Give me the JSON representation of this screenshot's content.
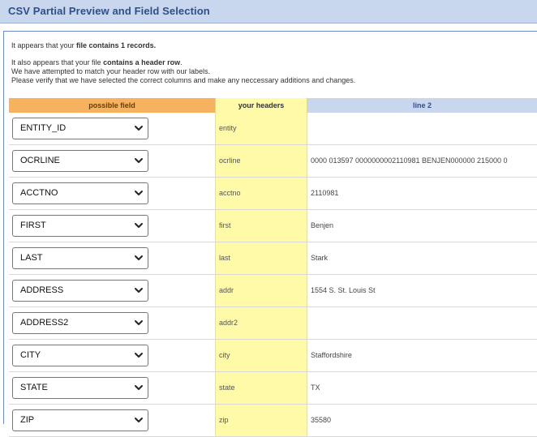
{
  "page": {
    "title": "CSV Partial Preview and Field Selection"
  },
  "intro": {
    "line1_pre": "It appears that your ",
    "line1_bold": "file contains 1 records.",
    "line2_pre": "It also appears that your file ",
    "line2_bold": "contains a header row",
    "line2_post": ".",
    "line3": "We have attempted to match your header row with our labels.",
    "line4": "Please verify that we have selected the correct columns and make any neccessary additions and changes."
  },
  "table": {
    "headers": {
      "possible_field": "possible field",
      "your_headers": "your headers",
      "line2": "line 2"
    },
    "rows": [
      {
        "field": "ENTITY_ID",
        "header": "entity",
        "value": ""
      },
      {
        "field": "OCRLINE",
        "header": "ocrline",
        "value": "0000 013597 0000000002110981 BENJEN000000 215000 0"
      },
      {
        "field": "ACCTNO",
        "header": "acctno",
        "value": "2110981"
      },
      {
        "field": "FIRST",
        "header": "first",
        "value": "Benjen"
      },
      {
        "field": "LAST",
        "header": "last",
        "value": "Stark"
      },
      {
        "field": "ADDRESS",
        "header": "addr",
        "value": "1554 S. St. Louis St"
      },
      {
        "field": "ADDRESS2",
        "header": "addr2",
        "value": ""
      },
      {
        "field": "CITY",
        "header": "city",
        "value": "Staffordshire"
      },
      {
        "field": "STATE",
        "header": "state",
        "value": "TX"
      },
      {
        "field": "ZIP",
        "header": "zip",
        "value": "35580"
      }
    ]
  },
  "icons": {
    "select_chevron": "chevron-down-icon"
  },
  "colors": {
    "title_bar": "#c8d6ee",
    "possible_field_header": "#f6b25e",
    "your_headers_column": "#fffaa8",
    "line2_header": "#c8d6ee"
  }
}
